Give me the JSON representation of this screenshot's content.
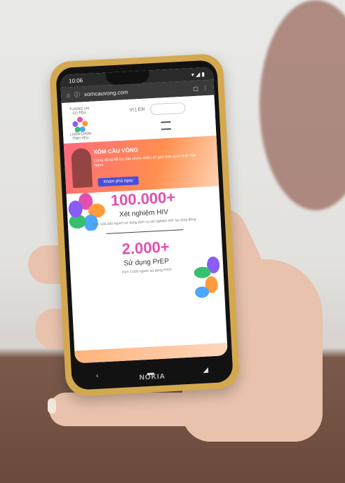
{
  "status": {
    "time": "10:06"
  },
  "browser": {
    "url": "xomcauvong.com"
  },
  "site": {
    "logo_top": "TƯƠNG LAI\nCÓ TẾU.",
    "logo_bottom": "LUÔN CHỌN\nTÌNH YÊU.",
    "lang": "VI | EN"
  },
  "hero": {
    "title": "XÓM CẦU VỒNG",
    "desc": "Cộng đồng hỗ trợ các nhóm thiểu số giới tính cool nhất Việt Nam!",
    "button": "Khám phá ngay"
  },
  "stats": [
    {
      "value": "100.000+",
      "label": "Xét nghiệm HIV",
      "desc": "Hơn 100.000 người sử dụng dịch vụ xét nghiệm HIV tại cộng đồng"
    },
    {
      "value": "2.000+",
      "label": "Sử dụng PrEP",
      "desc": "Hơn 2.000 người sử dụng PrEP"
    }
  ],
  "phone_brand": "NOKIA",
  "colors": {
    "accent_pink": "#e24fb0",
    "hero_start": "#ff6a7a",
    "hero_end": "#ffd2b0",
    "button": "#4b4fd8"
  }
}
